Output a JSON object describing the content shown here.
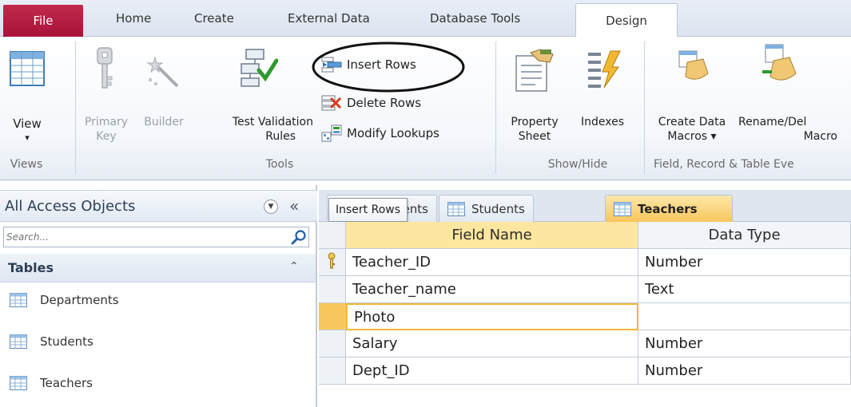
{
  "ribbon_tabs": {
    "file": "File",
    "home": "Home",
    "create": "Create",
    "external_data": "External Data",
    "database_tools": "Database Tools",
    "design": "Design"
  },
  "ribbon": {
    "views": {
      "view": "View",
      "group": "Views"
    },
    "tools": {
      "primary_key_1": "Primary",
      "primary_key_2": "Key",
      "builder": "Builder",
      "test_validation_1": "Test Validation",
      "test_validation_2": "Rules",
      "insert_rows": "Insert Rows",
      "delete_rows": "Delete Rows",
      "modify_lookups": "Modify Lookups",
      "group": "Tools"
    },
    "show_hide": {
      "property_sheet_1": "Property",
      "property_sheet_2": "Sheet",
      "indexes": "Indexes",
      "group": "Show/Hide"
    },
    "field_events": {
      "create_data_macros_1": "Create Data",
      "create_data_macros_2": "Macros ▾",
      "rename_delete_macro_1": "Rename/Del",
      "rename_delete_macro_2": "Macro",
      "group": "Field, Record & Table Eve"
    }
  },
  "nav": {
    "title": "All Access Objects",
    "search_placeholder": "Search...",
    "section": "Tables",
    "items": [
      "Departments",
      "Students",
      "Teachers"
    ]
  },
  "doc": {
    "tooltip": "Insert Rows",
    "tab_partial": "ents",
    "tabs": [
      "Students",
      "Teachers"
    ],
    "active_tab": "Teachers",
    "columns": [
      "Field Name",
      "Data Type"
    ],
    "rows": [
      {
        "field": "Teacher_ID",
        "type": "Number",
        "primary_key": true
      },
      {
        "field": "Teacher_name",
        "type": "Text"
      },
      {
        "field": "Photo",
        "type": "",
        "selected": true
      },
      {
        "field": "Salary",
        "type": "Number"
      },
      {
        "field": "Dept_ID",
        "type": "Number"
      }
    ]
  },
  "colors": {
    "file_tab": "#b31c40",
    "active_tab": "#f7c65c",
    "header_highlight": "#fde6a0",
    "selected_row": "#f7c65c"
  }
}
